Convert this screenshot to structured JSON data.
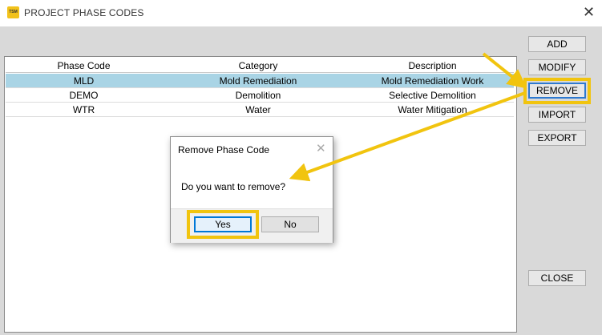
{
  "window": {
    "icon_text": "TSM",
    "title": "PROJECT PHASE CODES"
  },
  "grid": {
    "headers": [
      "Phase Code",
      "Category",
      "Description"
    ],
    "rows": [
      [
        "MLD",
        "Mold Remediation",
        "Mold Remediation Work"
      ],
      [
        "DEMO",
        "Demolition",
        "Selective Demolition"
      ],
      [
        "WTR",
        "Water",
        "Water Mitigation"
      ]
    ],
    "selected_row": 0
  },
  "buttons": {
    "add": "ADD",
    "modify": "MODIFY",
    "remove": "REMOVE",
    "import": "IMPORT",
    "export": "EXPORT",
    "close": "CLOSE"
  },
  "dialog": {
    "title": "Remove Phase Code",
    "message": "Do you want to remove?",
    "yes": "Yes",
    "no": "No"
  },
  "colors": {
    "highlight": "#f1c40f",
    "selected_row": "#a9d4e5",
    "focus": "#0078d7"
  }
}
